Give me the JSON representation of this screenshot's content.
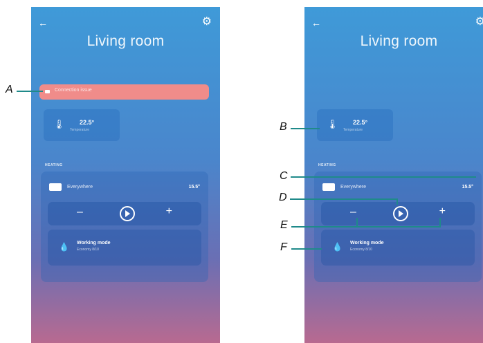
{
  "screen": {
    "title": "Living room",
    "alert_text": "Connection issue",
    "temperature": {
      "value": "22.5°",
      "label": "Temperature"
    },
    "section_label": "HEATING",
    "zone": {
      "name": "Everywhere",
      "temp": "15.5°"
    },
    "controls": {
      "minus": "–",
      "plus": "+"
    },
    "mode": {
      "title": "Working mode",
      "subtitle": "Economy 8/10"
    }
  },
  "icons": {
    "back": "back-arrow-icon",
    "settings": "gear-icon",
    "thermometer": "thermometer-icon",
    "play": "play-icon",
    "drop": "drop-icon"
  },
  "callouts": {
    "a": "A",
    "b": "B",
    "c": "C",
    "d": "D",
    "e": "E",
    "f": "F"
  },
  "colors": {
    "alert": "#f08c8a",
    "leader": "#1f8a8a"
  }
}
